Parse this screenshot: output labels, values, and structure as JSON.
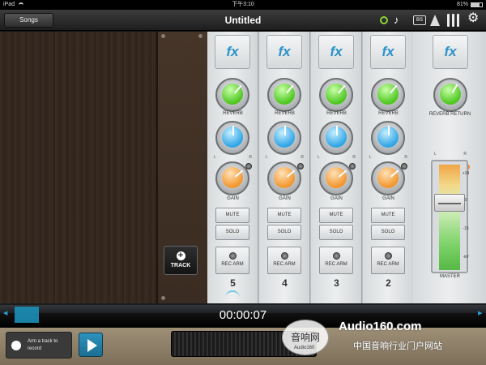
{
  "status_bar": {
    "device": "iPad",
    "time": "下午3:10",
    "battery": "81%"
  },
  "header": {
    "songs_label": "Songs",
    "title": "Untitled",
    "bs_label": "BS"
  },
  "track_button": {
    "label": "TRACK"
  },
  "channels": [
    {
      "number": "5",
      "fx": "fx",
      "reverb": "REVERB",
      "gain": "GAIN",
      "mute": "MUTE",
      "solo": "SOLO",
      "rec_arm": "REC ARM",
      "l": "L",
      "r": "R"
    },
    {
      "number": "4",
      "fx": "fx",
      "reverb": "REVERB",
      "gain": "GAIN",
      "mute": "MUTE",
      "solo": "SOLO",
      "rec_arm": "REC ARM",
      "l": "L",
      "r": "R"
    },
    {
      "number": "3",
      "fx": "fx",
      "reverb": "REVERB",
      "gain": "GAIN",
      "mute": "MUTE",
      "solo": "SOLO",
      "rec_arm": "REC ARM",
      "l": "L",
      "r": "R"
    },
    {
      "number": "2",
      "fx": "fx",
      "reverb": "REVERB",
      "gain": "GAIN",
      "mute": "MUTE",
      "solo": "SOLO",
      "rec_arm": "REC ARM",
      "l": "L",
      "r": "R"
    }
  ],
  "master": {
    "fx": "fx",
    "reverb_return": "REVERB RETURN",
    "label": "MASTER",
    "l": "L",
    "r": "R",
    "scale": [
      "+18",
      "0",
      "-15",
      "-inf"
    ]
  },
  "transport": {
    "timecode": "00:00:07"
  },
  "bottom": {
    "record_hint": "Arm a track to record"
  },
  "watermark": {
    "logo_cn": "音响网",
    "logo_small": "Audio160",
    "brand": "Audio160.com",
    "tagline": "中国音响行业门户网站"
  },
  "colors": {
    "accent_blue": "#2ba0d2",
    "reverb_green": "#4ec720",
    "pan_blue": "#2fa5e6",
    "gain_orange": "#f3962d"
  }
}
